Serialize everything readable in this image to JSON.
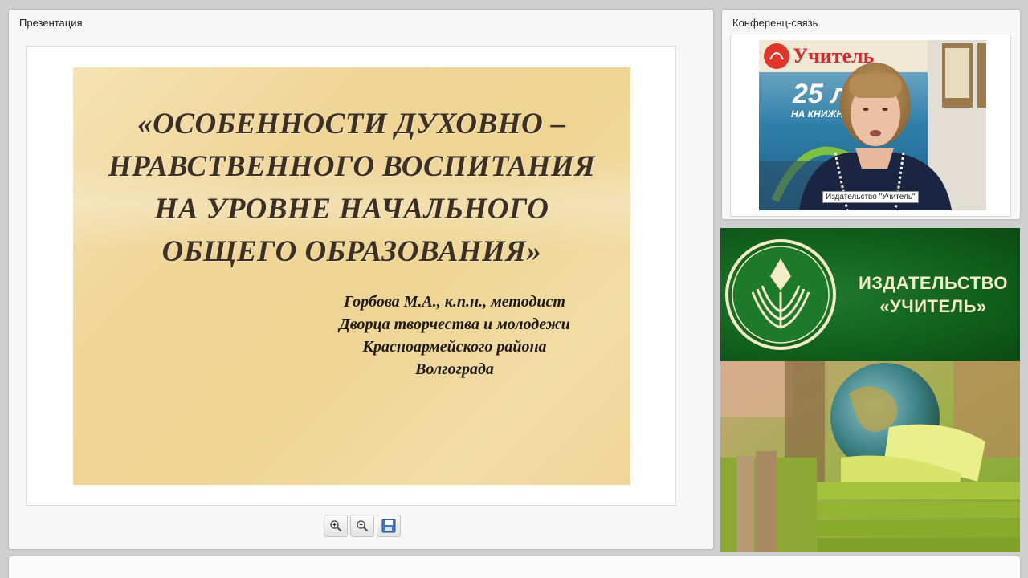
{
  "presentation": {
    "panel_title": "Презентация",
    "slide": {
      "title_lines": [
        "«ОСОБЕННОСТИ ДУХОВНО –",
        "НРАВСТВЕННОГО ВОСПИТАНИЯ",
        "НА УРОВНЕ НАЧАЛЬНОГО",
        "ОБЩЕГО ОБРАЗОВАНИЯ»"
      ],
      "author_lines": [
        "Горбова М.А., к.п.н., методист",
        "Дворца творчества и молодежи",
        "Красноармейского района",
        "Волгограда"
      ]
    },
    "toolbar": {
      "zoom_in_icon": "zoom-in-icon",
      "zoom_out_icon": "zoom-out-icon",
      "save_icon": "save-icon"
    }
  },
  "conference": {
    "panel_title": "Конференц-связь",
    "video_label": "Издательство \"Учитель\"",
    "backdrop_text": {
      "brand": "Учитель",
      "anniversary": "25 л",
      "tagline": "НА КНИЖН"
    }
  },
  "banner": {
    "name_lines": [
      "ИЗДАТЕЛЬСТВО",
      "«УЧИТЕЛЬ»"
    ]
  },
  "colors": {
    "banner_green": "#0f5a1a",
    "banner_text": "#f3ecc6",
    "slide_gold": "#eed593",
    "slide_title_text": "#3c3024"
  }
}
